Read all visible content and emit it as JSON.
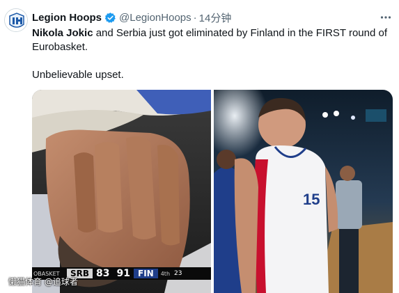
{
  "author": {
    "name": "Legion Hoops",
    "handle": "@LegionHoops",
    "separator": "·",
    "time": "14分钟"
  },
  "tweet": {
    "lead_bold": "Nikola Jokic",
    "line1_rest": " and Serbia just got eliminated by Finland in the FIRST round of Eurobasket.",
    "line2": "Unbelievable upset."
  },
  "scoreboard": {
    "league": "OBASKET",
    "team1": "SRB",
    "score1": "83",
    "score2": "91",
    "team2": "FIN",
    "quarter": "4th",
    "clock": "23"
  },
  "jersey_number": "15",
  "watermark": "懒猫体育 @追球者",
  "colors": {
    "verified_blue": "#1d9bf0",
    "text_primary": "#0f1419",
    "text_secondary": "#536471",
    "fin_blue": "#1f3e8a"
  },
  "icons": {
    "verified": "verified-badge-icon",
    "more": "more-horizontal-icon",
    "avatar": "legion-hoops-logo"
  }
}
